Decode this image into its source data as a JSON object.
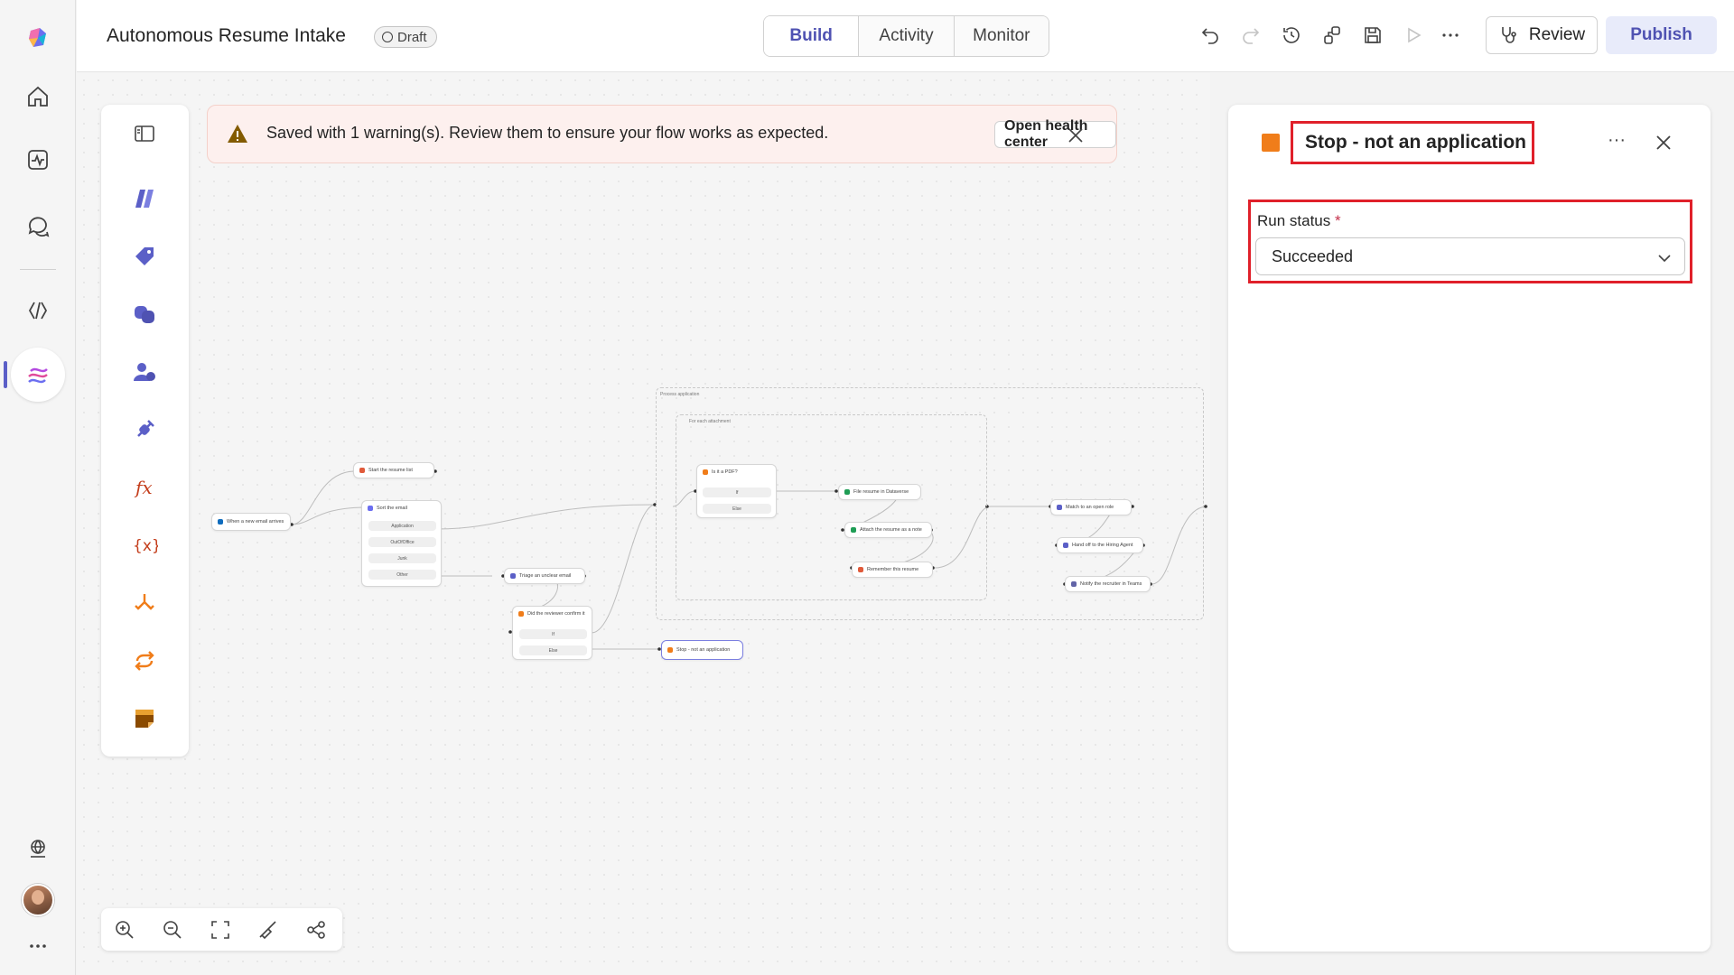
{
  "app": {
    "title": "Autonomous Resume Intake",
    "status_badge": "Draft"
  },
  "rail": {
    "items": [
      {
        "icon": "app-logo-icon"
      },
      {
        "icon": "home-icon"
      },
      {
        "icon": "activity-icon"
      },
      {
        "icon": "chat-icon"
      },
      {
        "icon": "code-icon"
      },
      {
        "icon": "flows-icon",
        "active": true
      },
      {
        "icon": "globe-icon"
      },
      {
        "icon": "avatar"
      },
      {
        "icon": "more-icon"
      }
    ]
  },
  "header": {
    "tabs": [
      {
        "label": "Build",
        "active": true
      },
      {
        "label": "Activity",
        "active": false
      },
      {
        "label": "Monitor",
        "active": false
      }
    ],
    "tools": [
      "undo-icon",
      "redo-icon",
      "history-icon",
      "connections-icon",
      "save-icon",
      "play-icon",
      "more-icon"
    ],
    "review_label": "Review",
    "publish_label": "Publish"
  },
  "palette": {
    "items": [
      "toggle-panel-icon",
      "agent-icon",
      "tag-icon",
      "copilot-icon",
      "person-icon",
      "connector-icon",
      "formula-icon",
      "variable-icon",
      "branch-icon",
      "loop-icon",
      "note-icon"
    ]
  },
  "warning": {
    "message": "Saved with 1 warning(s). Review them to ensure your flow works as expected.",
    "action_label": "Open health center"
  },
  "flow": {
    "nodes": {
      "trigger": "When a new email arrives",
      "start_list": "Start the resume list",
      "sort_email": "Sort the email",
      "sort_branches": [
        "Application",
        "OutOfOffice",
        "Junk",
        "Other"
      ],
      "triage": "Triage an unclear email",
      "reviewer_confirm": "Did the reviewer confirm it",
      "reviewer_branches": [
        "If",
        "Else"
      ],
      "stop": "Stop - not an application",
      "process_group": "Process application",
      "foreach_group": "For each attachment",
      "is_pdf": "Is it a PDF?",
      "pdf_branches": [
        "If",
        "Else"
      ],
      "file_resume": "File resume in Dataverse",
      "attach_note": "Attach the resume as a note",
      "remember": "Remember this resume",
      "match_role": "Match to an open role",
      "hand_off": "Hand off to the Hiring Agent",
      "notify": "Notify the recruiter in Teams"
    }
  },
  "zoom_tools": [
    "zoom-in-icon",
    "zoom-out-icon",
    "fit-view-icon",
    "clean-up-icon",
    "minimap-icon"
  ],
  "panel": {
    "title": "Stop - not an application",
    "field_label": "Run status",
    "required_mark": "*",
    "field_value": "Succeeded",
    "accent": "#f07d1a"
  },
  "colors": {
    "brand": "#5b5fc7",
    "highlight_border": "#e0202a",
    "warning_bg": "#fdf0ee"
  }
}
